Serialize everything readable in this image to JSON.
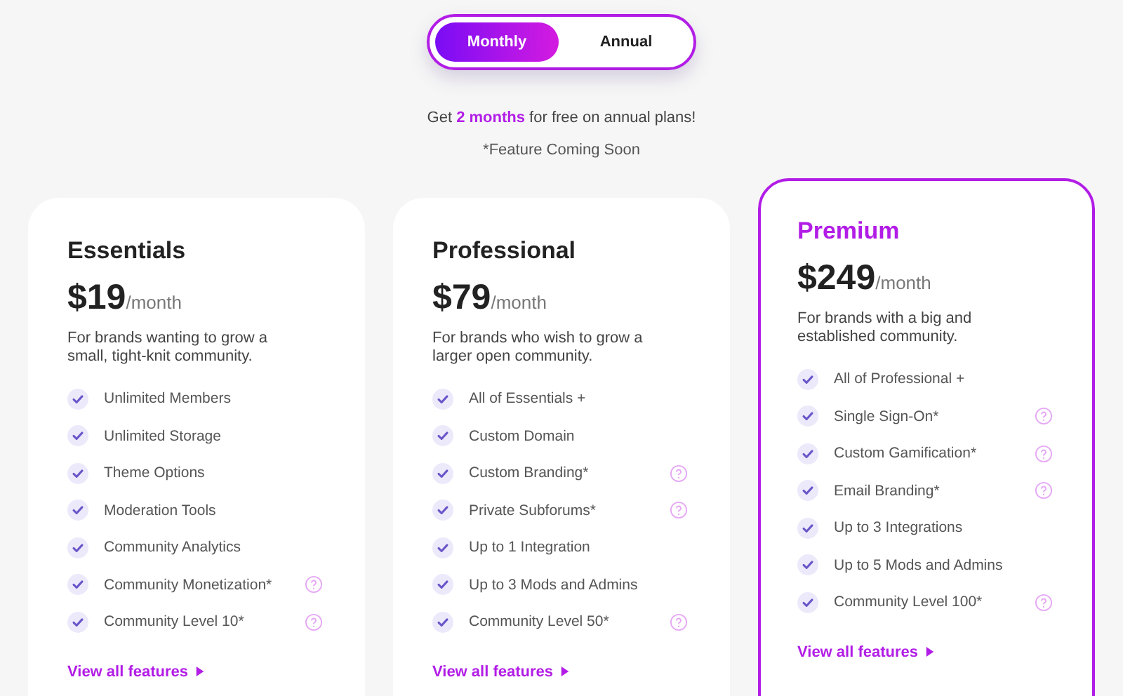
{
  "billing_toggle": [
    {
      "label": "Monthly",
      "selected": true
    },
    {
      "label": "Annual",
      "selected": false
    }
  ],
  "promo": "Get **2 months** for free on annual plans!",
  "footnote": "*Feature Coming Soon",
  "plans": [
    {
      "name": "Essentials",
      "highlighted": false,
      "price": "$19",
      "period": "/month",
      "description": "For brands wanting to grow a small, tight-knit community.",
      "features": [
        {
          "text": "Unlimited Members",
          "info": false
        },
        {
          "text": "Unlimited Storage",
          "info": false
        },
        {
          "text": "Theme Options",
          "info": false
        },
        {
          "text": "Moderation Tools",
          "info": false
        },
        {
          "text": "Community Analytics",
          "info": false
        },
        {
          "text": "Community Monetization*",
          "info": true
        },
        {
          "text": "Community Level 10*",
          "info": true
        }
      ],
      "link": "View all features"
    },
    {
      "name": "Professional",
      "highlighted": false,
      "price": "$79",
      "period": "/month",
      "description": "For brands who wish to grow a larger open community.",
      "features": [
        {
          "text": "All of Essentials +",
          "info": false
        },
        {
          "text": "Custom Domain",
          "info": false
        },
        {
          "text": "Custom Branding*",
          "info": true
        },
        {
          "text": "Private Subforums*",
          "info": true
        },
        {
          "text": "Up to 1 Integration",
          "info": false
        },
        {
          "text": "Up to 3 Mods and Admins",
          "info": false
        },
        {
          "text": "Community Level 50*",
          "info": true
        }
      ],
      "link": "View all features"
    },
    {
      "name": "Premium",
      "highlighted": true,
      "price": "$249",
      "period": "/month",
      "description": "For brands with a big and established community.",
      "features": [
        {
          "text": "All of Professional +",
          "info": false
        },
        {
          "text": "Single Sign-On*",
          "info": true
        },
        {
          "text": "Custom Gamification*",
          "info": true
        },
        {
          "text": "Email Branding*",
          "info": true
        },
        {
          "text": "Up to 3 Integrations",
          "info": false
        },
        {
          "text": "Up to 5 Mods and Admins",
          "info": false
        },
        {
          "text": "Community Level 100*",
          "info": true
        }
      ],
      "link": "View all features"
    }
  ]
}
